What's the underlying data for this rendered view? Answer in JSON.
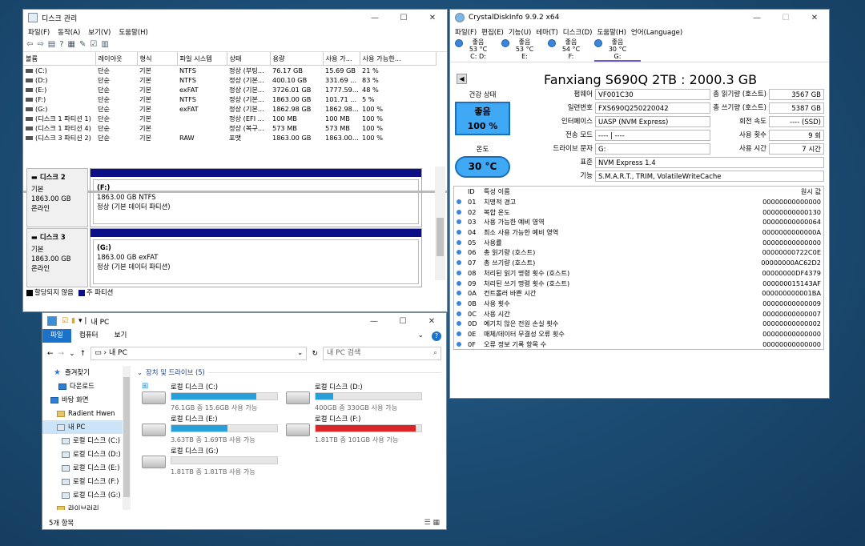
{
  "disk_mgmt": {
    "title": "디스크 관리",
    "menu": [
      "파일(F)",
      "동작(A)",
      "보기(V)",
      "도움말(H)"
    ],
    "columns": [
      "볼륨",
      "레이아웃",
      "형식",
      "파일 시스템",
      "상태",
      "용량",
      "사용 가...",
      "사용 가능한..."
    ],
    "rows": [
      [
        "(C:)",
        "단순",
        "기본",
        "NTFS",
        "정상 (부팅...",
        "76.17 GB",
        "15.69 GB",
        "21 %"
      ],
      [
        "(D:)",
        "단순",
        "기본",
        "NTFS",
        "정상 (기본...",
        "400.10 GB",
        "331.69 ...",
        "83 %"
      ],
      [
        "(E:)",
        "단순",
        "기본",
        "exFAT",
        "정상 (기본...",
        "3726.01 GB",
        "1777.59...",
        "48 %"
      ],
      [
        "(F:)",
        "단순",
        "기본",
        "NTFS",
        "정상 (기본...",
        "1863.00 GB",
        "101.71 ...",
        "5 %"
      ],
      [
        "(G:)",
        "단순",
        "기본",
        "exFAT",
        "정상 (기본...",
        "1862.98 GB",
        "1862.98...",
        "100 %"
      ],
      [
        "(디스크 1 파티션 1)",
        "단순",
        "기본",
        "",
        "정상 (EFI ...",
        "100 MB",
        "100 MB",
        "100 %"
      ],
      [
        "(디스크 1 파티션 4)",
        "단순",
        "기본",
        "",
        "정상 (복구...",
        "573 MB",
        "573 MB",
        "100 %"
      ],
      [
        "(디스크 3 파티션 2)",
        "단순",
        "기본",
        "RAW",
        "포맷",
        "1863.00 GB",
        "1863.00...",
        "100 %"
      ]
    ],
    "disks": [
      {
        "name": "디스크 2",
        "type": "기본",
        "size": "1863.00 GB",
        "state": "온라인",
        "part_label": "(F:)",
        "part_size": "1863.00 GB NTFS",
        "part_status": "정상 (기본 데이터 파티션)"
      },
      {
        "name": "디스크 3",
        "type": "기본",
        "size": "1863.00 GB",
        "state": "온라인",
        "part_label": "(G:)",
        "part_size": "1863.00 GB exFAT",
        "part_status": "정상 (기본 데이터 파티션)"
      }
    ],
    "legend": [
      "할당되지 않음",
      "주 파티션"
    ],
    "legend_colors": [
      "#000000",
      "#0b0e86"
    ]
  },
  "cdi": {
    "title": "CrystalDiskInfo 9.9.2 x64",
    "menu": [
      "파일(F)",
      "편집(E)",
      "기능(U)",
      "테마(T)",
      "디스크(D)",
      "도움말(H)",
      "언어(Language)"
    ],
    "drives": [
      {
        "status": "좋음",
        "temp": "53 °C",
        "letter": "C: D:"
      },
      {
        "status": "좋음",
        "temp": "53 °C",
        "letter": "E:"
      },
      {
        "status": "좋음",
        "temp": "54 °C",
        "letter": "F:"
      },
      {
        "status": "좋음",
        "temp": "30 °C",
        "letter": "G:"
      }
    ],
    "model": "Fanxiang S690Q 2TB : 2000.3 GB",
    "health_label": "건강 상태",
    "health_status": "좋음",
    "health_pct": "100 %",
    "temp_label": "온도",
    "temp": "30 °C",
    "firmware_label": "펌웨어",
    "firmware": "VF001C30",
    "serial_label": "일련번호",
    "serial": "FXS690Q250220042",
    "interface_label": "인터페이스",
    "interface": "UASP (NVM Express)",
    "transfer_label": "전송 모드",
    "transfer": "---- | ----",
    "drive_letter_label": "드라이브 문자",
    "drive_letter": "G:",
    "standard_label": "표준",
    "standard": "NVM Express 1.4",
    "features_label": "기능",
    "features": "S.M.A.R.T., TRIM, VolatileWriteCache",
    "reads_label": "총 읽기량 (호스트)",
    "reads": "3567 GB",
    "writes_label": "총 쓰기량 (호스트)",
    "writes": "5387 GB",
    "rotation_label": "회전 속도",
    "rotation": "---- (SSD)",
    "power_count_label": "사용 횟수",
    "power_count": "9 회",
    "power_hours_label": "사용 시간",
    "power_hours": "7 시간",
    "smart_headers": [
      "ID",
      "특성 이름",
      "원시 값"
    ],
    "smart": [
      [
        "01",
        "치명적 경고",
        "00000000000000"
      ],
      [
        "02",
        "복합 온도",
        "00000000000130"
      ],
      [
        "03",
        "사용 가능한 예비 영역",
        "00000000000064"
      ],
      [
        "04",
        "최소 사용 가능한 예비 영역",
        "0000000000000A"
      ],
      [
        "05",
        "사용률",
        "00000000000000"
      ],
      [
        "06",
        "총 읽기량 (호스트)",
        "00000000722C0E"
      ],
      [
        "07",
        "총 쓰기량 (호스트)",
        "00000000AC62D2"
      ],
      [
        "08",
        "처리된 읽기 명령 횟수 (호스트)",
        "00000000DF4379"
      ],
      [
        "09",
        "처리된 쓰기 명령 횟수 (호스트)",
        "000000015143AF"
      ],
      [
        "0A",
        "컨트롤러 바쁜 시간",
        "000000000001BA"
      ],
      [
        "0B",
        "사용 횟수",
        "00000000000009"
      ],
      [
        "0C",
        "사용 시간",
        "00000000000007"
      ],
      [
        "0D",
        "예기치 않은 전원 손실 횟수",
        "00000000000002"
      ],
      [
        "0E",
        "매체/데이터 무결성 오류 횟수",
        "00000000000000"
      ],
      [
        "0F",
        "오류 정보 기록 항목 수",
        "00000000000000"
      ]
    ]
  },
  "explorer": {
    "title": "내 PC",
    "ribbon": [
      "파일",
      "컴퓨터",
      "보기"
    ],
    "path": "내 PC",
    "search_placeholder": "내 PC 검색",
    "nav": [
      "즐겨찾기",
      "다운로드",
      "바탕 화면",
      "Radient Hwen",
      "내 PC",
      "로컬 디스크 (C:)",
      "로컬 디스크 (D:)",
      "로컬 디스크 (E:)",
      "로컬 디스크 (F:)",
      "로컬 디스크 (G:)",
      "라이브러리"
    ],
    "group": "장치 및 드라이브 (5)",
    "drives": [
      {
        "name": "로컬 디스크 (C:)",
        "info": "76.1GB 중 15.6GB 사용 가능",
        "used_fraction": 0.8,
        "color": "#26a0da"
      },
      {
        "name": "로컬 디스크 (D:)",
        "info": "400GB 중 330GB 사용 가능",
        "used_fraction": 0.17,
        "color": "#26a0da"
      },
      {
        "name": "로컬 디스크 (E:)",
        "info": "3.63TB 중 1.69TB 사용 가능",
        "used_fraction": 0.53,
        "color": "#26a0da"
      },
      {
        "name": "로컬 디스크 (F:)",
        "info": "1.81TB 중 101GB 사용 가능",
        "used_fraction": 0.95,
        "color": "#da2626"
      },
      {
        "name": "로컬 디스크 (G:)",
        "info": "1.81TB 중 1.81TB 사용 가능",
        "used_fraction": 0.0,
        "color": "#26a0da"
      }
    ],
    "status": "5개 항목"
  }
}
